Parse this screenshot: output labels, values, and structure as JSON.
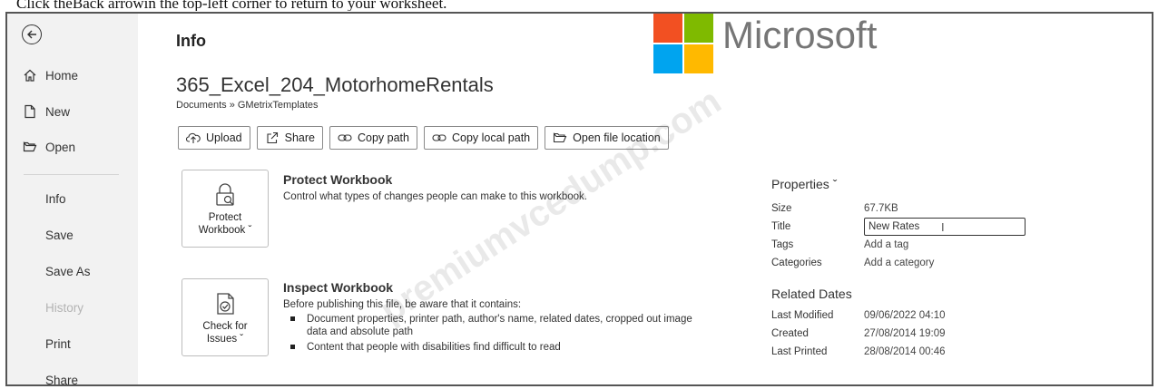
{
  "instruction": "Click theBack arrowin the top-left corner to return to your worksheet.",
  "sidebar": {
    "back_icon": "back-arrow-icon",
    "items": [
      {
        "label": "Home",
        "icon": "home-icon"
      },
      {
        "label": "New",
        "icon": "new-file-icon"
      },
      {
        "label": "Open",
        "icon": "folder-open-icon"
      },
      {
        "label": "Info"
      },
      {
        "label": "Save"
      },
      {
        "label": "Save As"
      },
      {
        "label": "History"
      },
      {
        "label": "Print"
      },
      {
        "label": "Share"
      }
    ]
  },
  "main": {
    "title": "Info",
    "file_name": "365_Excel_204_MotorhomeRentals",
    "breadcrumb": "Documents » GMetrixTemplates",
    "toolbar": [
      {
        "label": "Upload",
        "icon": "upload-icon"
      },
      {
        "label": "Share",
        "icon": "share-icon"
      },
      {
        "label": "Copy path",
        "icon": "link-icon"
      },
      {
        "label": "Copy local path",
        "icon": "link-icon"
      },
      {
        "label": "Open file location",
        "icon": "folder-open-icon"
      }
    ],
    "protect": {
      "button_line1": "Protect",
      "button_line2": "Workbook ˇ",
      "title": "Protect Workbook",
      "description": "Control what types of changes people can make to this workbook."
    },
    "inspect": {
      "button_line1": "Check for",
      "button_line2": "Issues ˇ",
      "title": "Inspect Workbook",
      "description": "Before publishing this file, be aware that it contains:",
      "bullets": [
        "Document properties, printer path, author's name, related dates, cropped out image data and absolute path",
        "Content that people with disabilities find difficult to read"
      ]
    }
  },
  "properties": {
    "heading": "Properties ˇ",
    "size_label": "Size",
    "size_value": "67.7KB",
    "title_label": "Title",
    "title_value": "New Rates",
    "tags_label": "Tags",
    "tags_value": "Add a tag",
    "categories_label": "Categories",
    "categories_value": "Add a category"
  },
  "related_dates": {
    "heading": "Related Dates",
    "last_modified_label": "Last Modified",
    "last_modified_value": "09/06/2022 04:10",
    "created_label": "Created",
    "created_value": "27/08/2014 19:09",
    "last_printed_label": "Last Printed",
    "last_printed_value": "28/08/2014 00:46"
  },
  "logo": {
    "text": "Microsoft",
    "colors": [
      "#f25022",
      "#7fba00",
      "#00a4ef",
      "#ffb900"
    ]
  },
  "watermark": "premiumvcedump.com"
}
